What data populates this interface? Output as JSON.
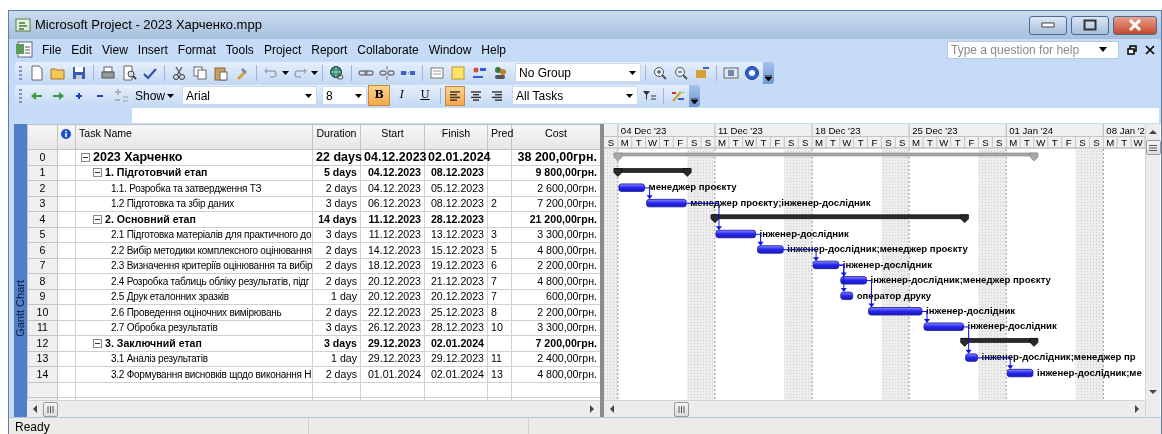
{
  "window": {
    "title": "Microsoft Project - 2023 Харченко.mpp"
  },
  "menu": [
    "File",
    "Edit",
    "View",
    "Insert",
    "Format",
    "Tools",
    "Project",
    "Report",
    "Collaborate",
    "Window",
    "Help"
  ],
  "help_search": {
    "placeholder": "Type a question for help"
  },
  "standard_toolbar": {
    "group": "No Group"
  },
  "formatting_toolbar": {
    "show": "Show",
    "font": "Arial",
    "size": "8",
    "styles": [
      {
        "kind": "bold",
        "label": "B",
        "selected": true
      },
      {
        "kind": "italic",
        "label": "I",
        "selected": false
      },
      {
        "kind": "underline",
        "label": "U",
        "selected": false
      }
    ],
    "align": [
      {
        "kind": "left",
        "selected": true
      },
      {
        "kind": "center",
        "selected": false
      },
      {
        "kind": "right",
        "selected": false
      }
    ],
    "filter": "All Tasks"
  },
  "view_bar": {
    "label": "Gantt Chart"
  },
  "table": {
    "columns": [
      "Task Name",
      "Duration",
      "Start",
      "Finish",
      "Pred",
      "Cost"
    ],
    "rows": [
      {
        "id": "0",
        "kind": "project",
        "expanded": true,
        "name": "2023 Харченко",
        "duration": "22 days",
        "start": "04.12.2023",
        "finish": "02.01.2024",
        "pred": "",
        "cost": "38 200,00грн."
      },
      {
        "id": "1",
        "kind": "summary",
        "expanded": true,
        "name": "1. Підготовчий етап",
        "duration": "5 days",
        "start": "04.12.2023",
        "finish": "08.12.2023",
        "pred": "",
        "cost": "9 800,00грн."
      },
      {
        "id": "2",
        "kind": "task",
        "name": "1.1. Розробка та затвердження ТЗ",
        "duration": "2 days",
        "start": "04.12.2023",
        "finish": "05.12.2023",
        "pred": "",
        "cost": "2 600,00грн.",
        "resources": "менеджер проєкту"
      },
      {
        "id": "3",
        "kind": "task",
        "name": "1.2 Підготовка та збір даних",
        "duration": "3 days",
        "start": "06.12.2023",
        "finish": "08.12.2023",
        "pred": "2",
        "cost": "7 200,00грн.",
        "resources": "менеджер проєкту;інженер-дослідник"
      },
      {
        "id": "4",
        "kind": "summary",
        "expanded": true,
        "name": "2. Основний етап",
        "duration": "14 days",
        "start": "11.12.2023",
        "finish": "28.12.2023",
        "pred": "",
        "cost": "21 200,00грн."
      },
      {
        "id": "5",
        "kind": "task",
        "name": "2.1 Підготовка матеріалів для практичного до",
        "duration": "3 days",
        "start": "11.12.2023",
        "finish": "13.12.2023",
        "pred": "3",
        "cost": "3 300,00грн.",
        "resources": "інженер-дослідник"
      },
      {
        "id": "6",
        "kind": "task",
        "name": "2.2 Вибір методики комплексного оцінювання",
        "duration": "2 days",
        "start": "14.12.2023",
        "finish": "15.12.2023",
        "pred": "5",
        "cost": "4 800,00грн.",
        "resources": "інженер-дослідник;менеджер проєкту"
      },
      {
        "id": "7",
        "kind": "task",
        "name": "2.3 Визначення критеріїв оцінювання та вибір",
        "duration": "2 days",
        "start": "18.12.2023",
        "finish": "19.12.2023",
        "pred": "6",
        "cost": "2 200,00грн.",
        "resources": "інженер-дослідник"
      },
      {
        "id": "8",
        "kind": "task",
        "name": "2.4 Розробка таблиць обліку результатів, підг",
        "duration": "2 days",
        "start": "20.12.2023",
        "finish": "21.12.2023",
        "pred": "7",
        "cost": "4 800,00грн.",
        "resources": "інженер-дослідник;менеджер проєкту"
      },
      {
        "id": "9",
        "kind": "task",
        "name": "2.5 Друк еталонних зразків",
        "duration": "1 day",
        "start": "20.12.2023",
        "finish": "20.12.2023",
        "pred": "7",
        "cost": "600,00грн.",
        "resources": "оператор друку"
      },
      {
        "id": "10",
        "kind": "task",
        "name": "2.6 Проведення оціночних вимірювань",
        "duration": "2 days",
        "start": "22.12.2023",
        "finish": "25.12.2023",
        "pred": "8",
        "cost": "2 200,00грн.",
        "resources": "інженер-дослідник"
      },
      {
        "id": "11",
        "kind": "task",
        "name": "2.7 Обробка результатів",
        "duration": "3 days",
        "start": "26.12.2023",
        "finish": "28.12.2023",
        "pred": "10",
        "cost": "3 300,00грн.",
        "resources": "інженер-дослідник"
      },
      {
        "id": "12",
        "kind": "summary",
        "expanded": true,
        "name": "3. Заключний етап",
        "duration": "3 days",
        "start": "29.12.2023",
        "finish": "02.01.2024",
        "pred": "",
        "cost": "7 200,00грн."
      },
      {
        "id": "13",
        "kind": "task",
        "name": "3.1 Аналіз результатів",
        "duration": "1 day",
        "start": "29.12.2023",
        "finish": "29.12.2023",
        "pred": "11",
        "cost": "2 400,00грн.",
        "resources": "інженер-дослідник;менеджер пр"
      },
      {
        "id": "14",
        "kind": "task",
        "name": "3.2 Формування висновків щодо виконання Н",
        "duration": "2 days",
        "start": "01.01.2024",
        "finish": "02.01.2024",
        "pred": "13",
        "cost": "4 800,00грн.",
        "resources": "інженер-дослідник;ме"
      }
    ]
  },
  "timescale": {
    "weeks": [
      "04 Dec '23",
      "11 Dec '23",
      "18 Dec '23",
      "25 Dec '23",
      "01 Jan '24",
      "08 Jan '2"
    ],
    "days": [
      "S",
      "M",
      "T",
      "W",
      "T",
      "F",
      "S",
      "S",
      "M",
      "T",
      "W",
      "T",
      "F",
      "S",
      "S",
      "M",
      "T",
      "W",
      "T",
      "F",
      "S",
      "S",
      "M",
      "T",
      "W",
      "T",
      "F",
      "S",
      "S",
      "M",
      "T",
      "W",
      "T",
      "F",
      "S",
      "S",
      "M",
      "T",
      "W"
    ]
  },
  "status_bar": {
    "text": "Ready"
  }
}
